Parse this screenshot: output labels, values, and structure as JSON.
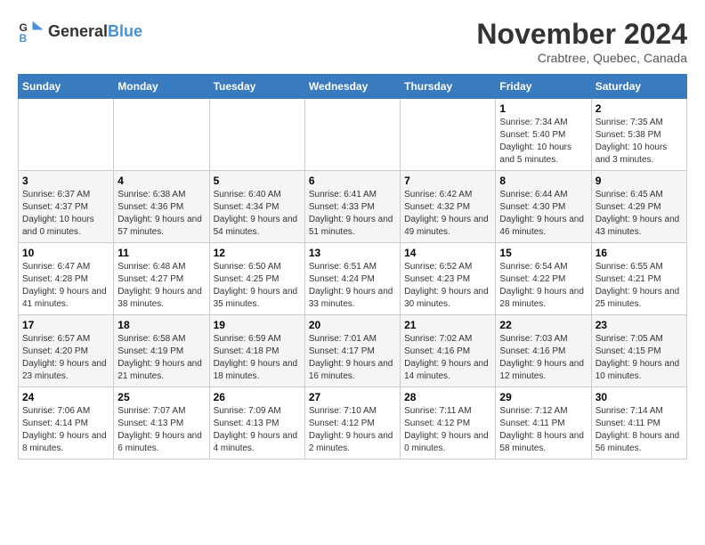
{
  "logo": {
    "text_general": "General",
    "text_blue": "Blue"
  },
  "header": {
    "month_title": "November 2024",
    "subtitle": "Crabtree, Quebec, Canada"
  },
  "calendar": {
    "days_of_week": [
      "Sunday",
      "Monday",
      "Tuesday",
      "Wednesday",
      "Thursday",
      "Friday",
      "Saturday"
    ],
    "weeks": [
      [
        {
          "day": "",
          "info": ""
        },
        {
          "day": "",
          "info": ""
        },
        {
          "day": "",
          "info": ""
        },
        {
          "day": "",
          "info": ""
        },
        {
          "day": "",
          "info": ""
        },
        {
          "day": "1",
          "info": "Sunrise: 7:34 AM\nSunset: 5:40 PM\nDaylight: 10 hours and 5 minutes."
        },
        {
          "day": "2",
          "info": "Sunrise: 7:35 AM\nSunset: 5:38 PM\nDaylight: 10 hours and 3 minutes."
        }
      ],
      [
        {
          "day": "3",
          "info": "Sunrise: 6:37 AM\nSunset: 4:37 PM\nDaylight: 10 hours and 0 minutes."
        },
        {
          "day": "4",
          "info": "Sunrise: 6:38 AM\nSunset: 4:36 PM\nDaylight: 9 hours and 57 minutes."
        },
        {
          "day": "5",
          "info": "Sunrise: 6:40 AM\nSunset: 4:34 PM\nDaylight: 9 hours and 54 minutes."
        },
        {
          "day": "6",
          "info": "Sunrise: 6:41 AM\nSunset: 4:33 PM\nDaylight: 9 hours and 51 minutes."
        },
        {
          "day": "7",
          "info": "Sunrise: 6:42 AM\nSunset: 4:32 PM\nDaylight: 9 hours and 49 minutes."
        },
        {
          "day": "8",
          "info": "Sunrise: 6:44 AM\nSunset: 4:30 PM\nDaylight: 9 hours and 46 minutes."
        },
        {
          "day": "9",
          "info": "Sunrise: 6:45 AM\nSunset: 4:29 PM\nDaylight: 9 hours and 43 minutes."
        }
      ],
      [
        {
          "day": "10",
          "info": "Sunrise: 6:47 AM\nSunset: 4:28 PM\nDaylight: 9 hours and 41 minutes."
        },
        {
          "day": "11",
          "info": "Sunrise: 6:48 AM\nSunset: 4:27 PM\nDaylight: 9 hours and 38 minutes."
        },
        {
          "day": "12",
          "info": "Sunrise: 6:50 AM\nSunset: 4:25 PM\nDaylight: 9 hours and 35 minutes."
        },
        {
          "day": "13",
          "info": "Sunrise: 6:51 AM\nSunset: 4:24 PM\nDaylight: 9 hours and 33 minutes."
        },
        {
          "day": "14",
          "info": "Sunrise: 6:52 AM\nSunset: 4:23 PM\nDaylight: 9 hours and 30 minutes."
        },
        {
          "day": "15",
          "info": "Sunrise: 6:54 AM\nSunset: 4:22 PM\nDaylight: 9 hours and 28 minutes."
        },
        {
          "day": "16",
          "info": "Sunrise: 6:55 AM\nSunset: 4:21 PM\nDaylight: 9 hours and 25 minutes."
        }
      ],
      [
        {
          "day": "17",
          "info": "Sunrise: 6:57 AM\nSunset: 4:20 PM\nDaylight: 9 hours and 23 minutes."
        },
        {
          "day": "18",
          "info": "Sunrise: 6:58 AM\nSunset: 4:19 PM\nDaylight: 9 hours and 21 minutes."
        },
        {
          "day": "19",
          "info": "Sunrise: 6:59 AM\nSunset: 4:18 PM\nDaylight: 9 hours and 18 minutes."
        },
        {
          "day": "20",
          "info": "Sunrise: 7:01 AM\nSunset: 4:17 PM\nDaylight: 9 hours and 16 minutes."
        },
        {
          "day": "21",
          "info": "Sunrise: 7:02 AM\nSunset: 4:16 PM\nDaylight: 9 hours and 14 minutes."
        },
        {
          "day": "22",
          "info": "Sunrise: 7:03 AM\nSunset: 4:16 PM\nDaylight: 9 hours and 12 minutes."
        },
        {
          "day": "23",
          "info": "Sunrise: 7:05 AM\nSunset: 4:15 PM\nDaylight: 9 hours and 10 minutes."
        }
      ],
      [
        {
          "day": "24",
          "info": "Sunrise: 7:06 AM\nSunset: 4:14 PM\nDaylight: 9 hours and 8 minutes."
        },
        {
          "day": "25",
          "info": "Sunrise: 7:07 AM\nSunset: 4:13 PM\nDaylight: 9 hours and 6 minutes."
        },
        {
          "day": "26",
          "info": "Sunrise: 7:09 AM\nSunset: 4:13 PM\nDaylight: 9 hours and 4 minutes."
        },
        {
          "day": "27",
          "info": "Sunrise: 7:10 AM\nSunset: 4:12 PM\nDaylight: 9 hours and 2 minutes."
        },
        {
          "day": "28",
          "info": "Sunrise: 7:11 AM\nSunset: 4:12 PM\nDaylight: 9 hours and 0 minutes."
        },
        {
          "day": "29",
          "info": "Sunrise: 7:12 AM\nSunset: 4:11 PM\nDaylight: 8 hours and 58 minutes."
        },
        {
          "day": "30",
          "info": "Sunrise: 7:14 AM\nSunset: 4:11 PM\nDaylight: 8 hours and 56 minutes."
        }
      ]
    ]
  }
}
